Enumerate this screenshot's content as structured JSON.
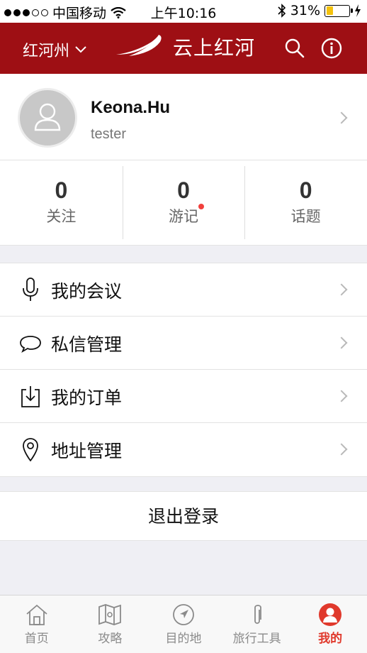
{
  "status_bar": {
    "carrier": "中国移动",
    "time": "上午10:16",
    "battery": "31%",
    "battery_level": 0.31
  },
  "header": {
    "city": "红河州",
    "title": "云上红河",
    "icons": [
      "search-icon",
      "info-icon"
    ],
    "background": "#9e0f14"
  },
  "profile": {
    "name": "Keona.Hu",
    "role": "tester"
  },
  "stats": [
    {
      "value": "0",
      "label": "关注"
    },
    {
      "value": "0",
      "label": "游记",
      "badge": true
    },
    {
      "value": "0",
      "label": "话题"
    }
  ],
  "menu": [
    {
      "label": "我的会议",
      "icon": "microphone-icon"
    },
    {
      "label": "私信管理",
      "icon": "chat-bubble-icon"
    },
    {
      "label": "我的订单",
      "icon": "download-box-icon"
    },
    {
      "label": "地址管理",
      "icon": "location-pin-icon"
    }
  ],
  "logout_label": "退出登录",
  "tabs": [
    {
      "label": "首页",
      "icon": "home-icon"
    },
    {
      "label": "攻略",
      "icon": "map-icon"
    },
    {
      "label": "目的地",
      "icon": "compass-icon"
    },
    {
      "label": "旅行工具",
      "icon": "paperclip-icon"
    },
    {
      "label": "我的",
      "icon": "user-icon",
      "active": true
    }
  ],
  "colors": {
    "accent": "#e0392c",
    "brand": "#9e0f14",
    "badge": "#f1403c"
  }
}
